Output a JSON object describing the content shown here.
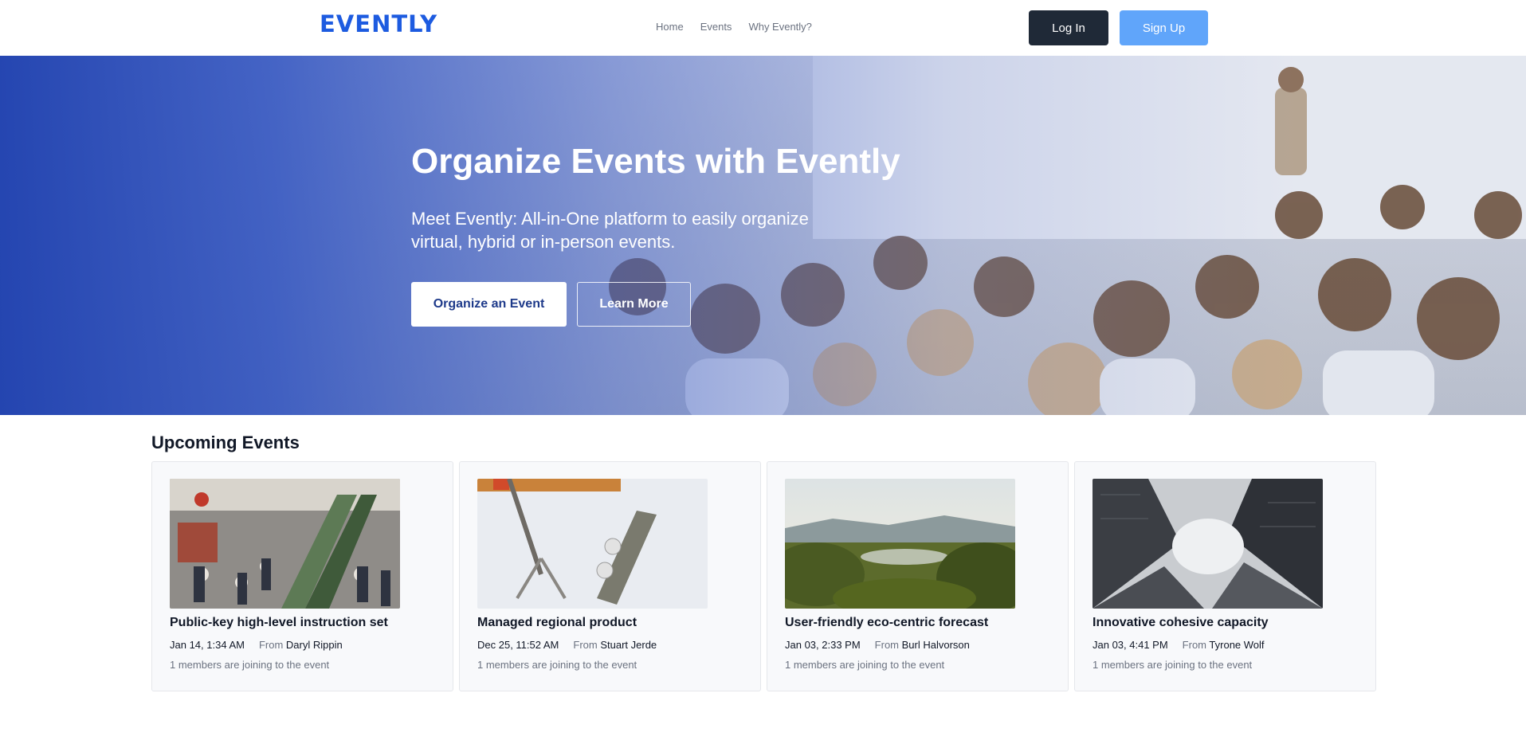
{
  "header": {
    "logo": "EVENTLY",
    "nav": [
      "Home",
      "Events",
      "Why Evently?"
    ],
    "login_label": "Log In",
    "signup_label": "Sign Up"
  },
  "hero": {
    "title": "Organize Events with Evently",
    "subtitle": "Meet Evently: All-in-One platform to easily organize virtual, hybrid or in-person events.",
    "primary_button": "Organize an Event",
    "secondary_button": "Learn More"
  },
  "upcoming": {
    "title": "Upcoming Events",
    "from_label": "From",
    "events": [
      {
        "title": "Public-key high-level instruction set",
        "date": "Jan 14, 1:34 AM",
        "organizer": "Daryl Rippin",
        "members": "1 members are joining to the event"
      },
      {
        "title": "Managed regional product",
        "date": "Dec 25, 11:52 AM",
        "organizer": "Stuart Jerde",
        "members": "1 members are joining to the event"
      },
      {
        "title": "User-friendly eco-centric forecast",
        "date": "Jan 03, 2:33 PM",
        "organizer": "Burl Halvorson",
        "members": "1 members are joining to the event"
      },
      {
        "title": "Innovative cohesive capacity",
        "date": "Jan 03, 4:41 PM",
        "organizer": "Tyrone Wolf",
        "members": "1 members are joining to the event"
      }
    ]
  },
  "colors": {
    "brand": "#1d5be0",
    "login_bg": "#1f2937",
    "signup_bg": "#60a5fa",
    "hero_overlay": "#1e40af"
  }
}
